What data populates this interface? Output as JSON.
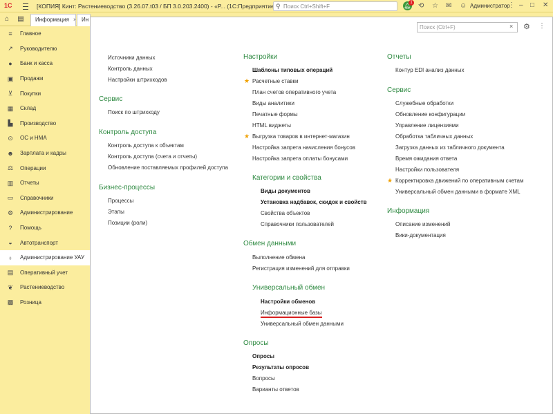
{
  "titlebar": {
    "logo": "1С",
    "title": "[КОПИЯ] Кинт: Растениеводство (3.26.07.t03 / БП 3.0.203.2400) - «Р...   (1С:Предприятие)",
    "search_placeholder": "Поиск Ctrl+Shift+F",
    "notification_count": "1",
    "user": "Администратор"
  },
  "tabbar": {
    "tabs": [
      {
        "label": "Информация"
      },
      {
        "label": "Ин"
      }
    ]
  },
  "sidebar": {
    "items": [
      {
        "label": "Главное",
        "icon": "list-icon"
      },
      {
        "label": "Руководителю",
        "icon": "trend-icon"
      },
      {
        "label": "Банк и касса",
        "icon": "coin-icon"
      },
      {
        "label": "Продажи",
        "icon": "bag-icon"
      },
      {
        "label": "Покупки",
        "icon": "cart-icon"
      },
      {
        "label": "Склад",
        "icon": "warehouse-icon"
      },
      {
        "label": "Производство",
        "icon": "factory-icon"
      },
      {
        "label": "ОС и НМА",
        "icon": "car-icon"
      },
      {
        "label": "Зарплата и кадры",
        "icon": "people-icon"
      },
      {
        "label": "Операции",
        "icon": "scales-icon"
      },
      {
        "label": "Отчеты",
        "icon": "chart-icon"
      },
      {
        "label": "Справочники",
        "icon": "book-icon"
      },
      {
        "label": "Администрирование",
        "icon": "gear-icon"
      },
      {
        "label": "Помощь",
        "icon": "question-icon"
      },
      {
        "label": "Автотранспорт",
        "icon": "truck-icon"
      },
      {
        "label": "Администрирование УАУ",
        "icon": "bulb-icon"
      },
      {
        "label": "Оперативный учет",
        "icon": "clipboard-icon"
      },
      {
        "label": "Растениеводство",
        "icon": "plant-icon"
      },
      {
        "label": "Розница",
        "icon": "register-icon"
      }
    ]
  },
  "main": {
    "search_placeholder": "Поиск (Ctrl+F)",
    "col1": {
      "top_links": [
        "Источники данных",
        "Контроль данных",
        "Настройки штрихкодов"
      ],
      "service_title": "Сервис",
      "service_links": [
        "Поиск по штрихкоду"
      ],
      "access_title": "Контроль доступа",
      "access_links": [
        "Контроль доступа к объектам",
        "Контроль доступа (счета и отчеты)",
        "Обновление поставляемых профилей доступа"
      ],
      "bp_title": "Бизнес-процессы",
      "bp_links": [
        "Процессы",
        "Этапы",
        "Позиции (роли)"
      ]
    },
    "col2": {
      "settings_title": "Настройки",
      "settings_links": [
        "Шаблоны типовых операций",
        "Расчетные ставки",
        "План счетов оперативного учета",
        "Виды аналитики",
        "Печатные формы",
        "HTML виджеты",
        "Выгрузка товаров в интернет-магазин",
        "Настройка запрета начисления бонусов",
        "Настройка запрета оплаты бонусами"
      ],
      "cat_title": "Категории и свойства",
      "cat_links": [
        "Виды документов",
        "Установка надбавок, скидок и свойств",
        "Свойства объектов",
        "Справочники пользователей"
      ],
      "exchange_title": "Обмен данными",
      "exchange_links": [
        "Выполнение обмена",
        "Регистрация изменений для отправки"
      ],
      "univ_title": "Универсальный обмен",
      "univ_links": [
        "Настройки обменов",
        "Информационные базы",
        "Универсальный обмен данными"
      ],
      "polls_title": "Опросы",
      "polls_links": [
        "Опросы",
        "Результаты опросов",
        "Вопросы",
        "Варианты ответов"
      ]
    },
    "col3": {
      "reports_title": "Отчеты",
      "reports_links": [
        "Контур EDI анализ данных"
      ],
      "service_title": "Сервис",
      "service_links": [
        "Служебные обработки",
        "Обновление конфигурации",
        "Управление лицензиями",
        "Обработка табличных данных",
        "Загрузка данных из табличного документа",
        "Время ожидания ответа",
        "Настройки пользователя",
        "Корректировка движений по оперативным счетам",
        "Универсальный обмен данными в формате XML"
      ],
      "info_title": "Информация",
      "info_links": [
        "Описание изменений",
        "Вики-документация"
      ]
    }
  },
  "colors": {
    "section_green": "#2f8a42",
    "sidebar_bg": "#fbed9e",
    "star": "#f0a000",
    "underline": "#d81e1e"
  }
}
